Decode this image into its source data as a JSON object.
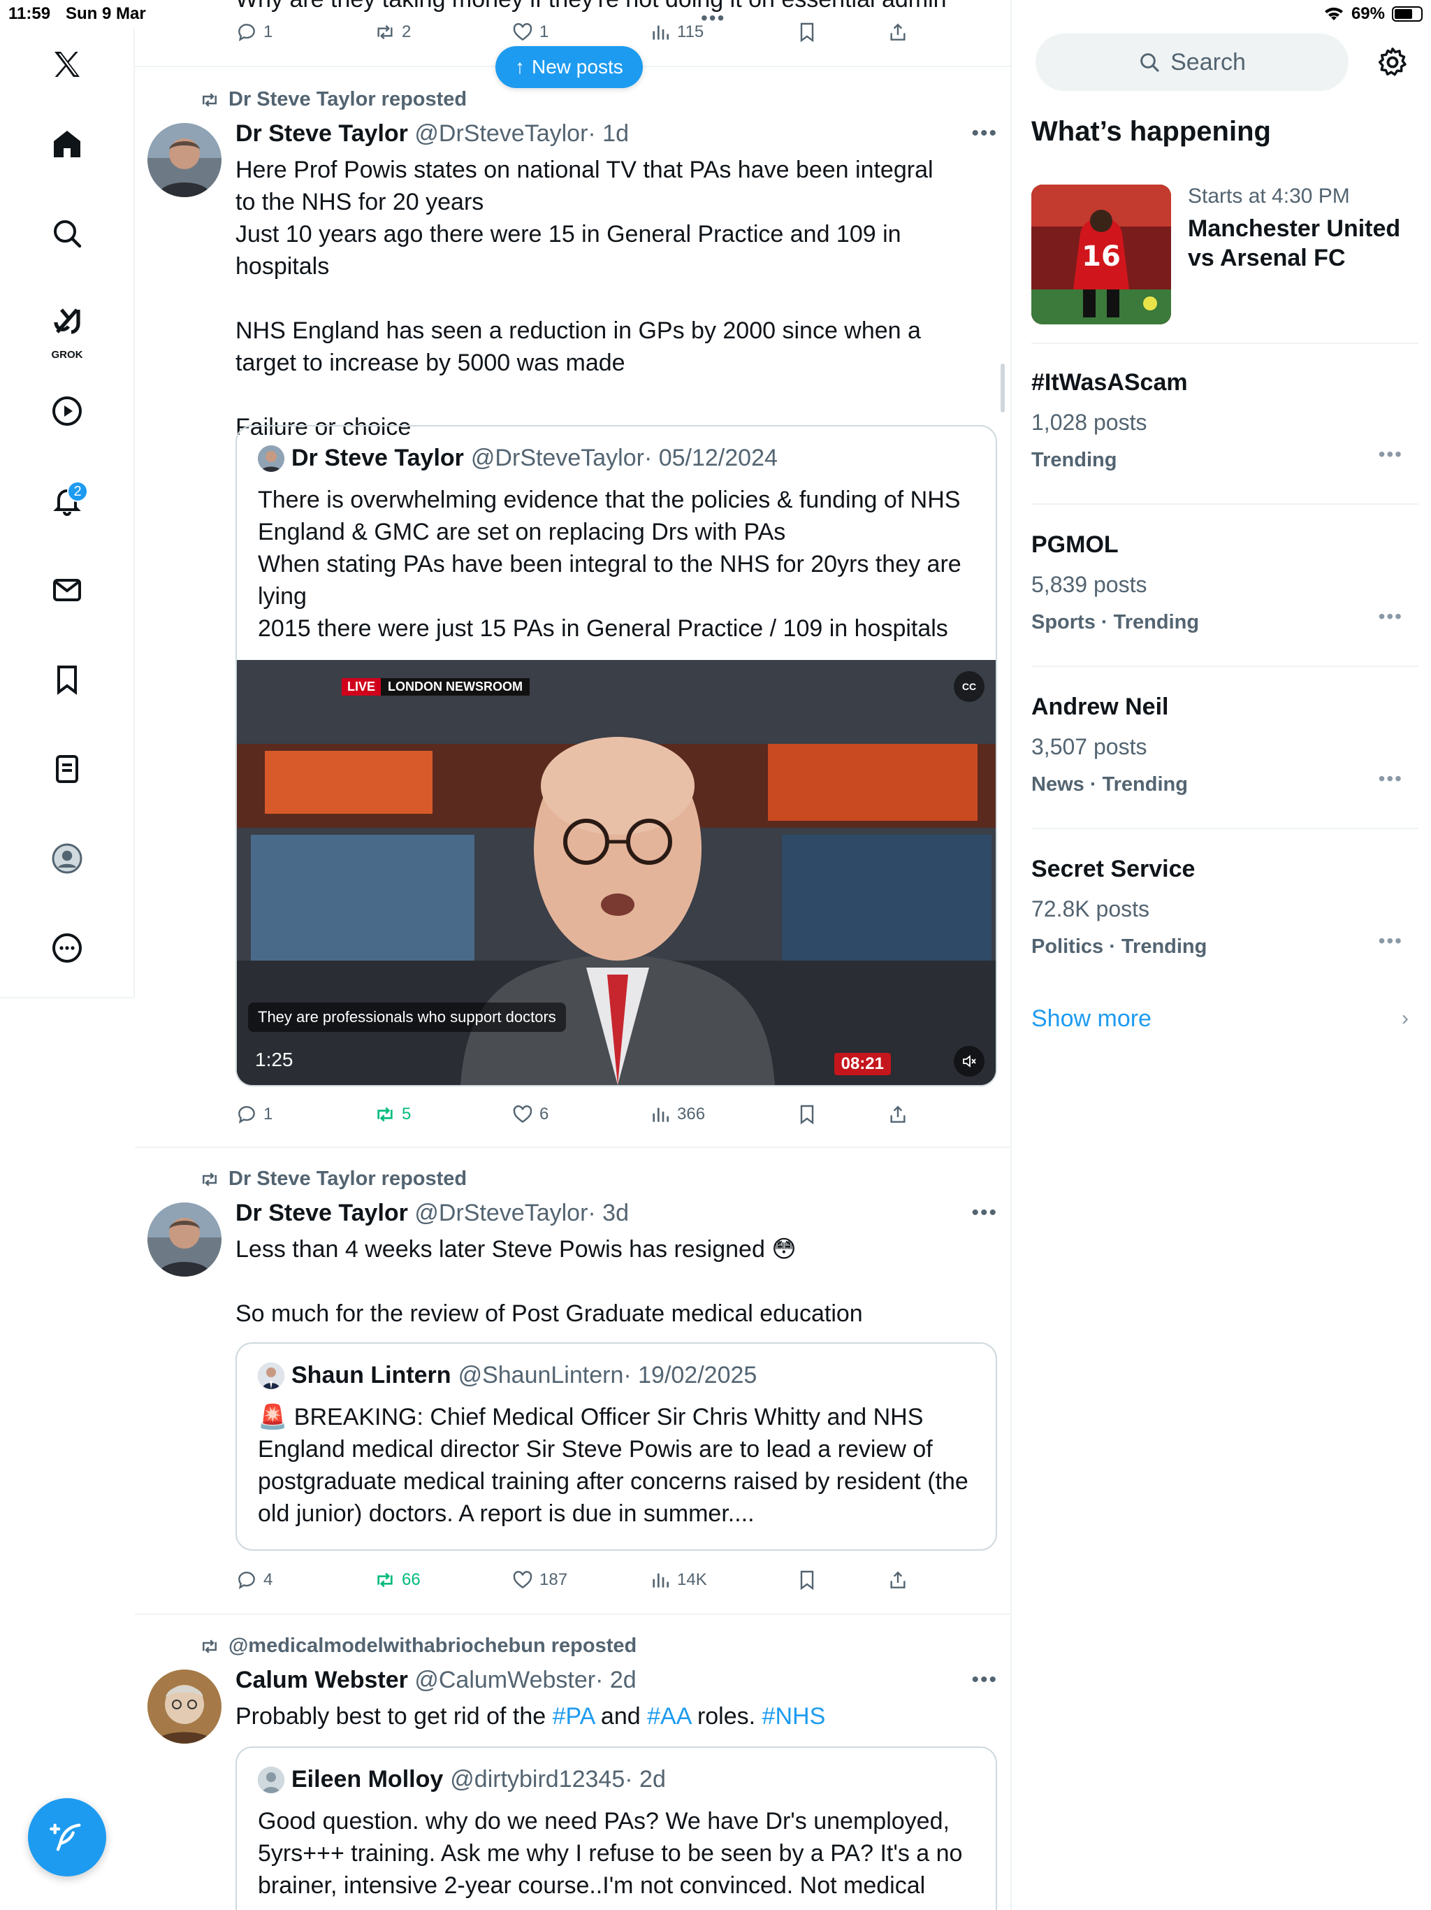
{
  "status_bar": {
    "time": "11:59",
    "date": "Sun 9 Mar",
    "battery": "69%",
    "battery_level": 0.69
  },
  "nav": {
    "items": [
      "x-logo",
      "home",
      "explore",
      "grok",
      "video",
      "notifications",
      "messages",
      "bookmarks",
      "lists",
      "profile",
      "more"
    ],
    "grok_label": "GROK",
    "notification_count": "2"
  },
  "timeline": {
    "cut_text": "Why are they taking money if they're not doing it on essential admin",
    "top_actions": {
      "replies": "1",
      "reposts": "2",
      "likes": "1",
      "views": "115"
    },
    "new_posts_label": "New posts",
    "posts": [
      {
        "repost_by": "Dr Steve Taylor reposted",
        "name": "Dr Steve Taylor",
        "handle": "@DrSteveTaylor",
        "time": "· 1d",
        "text": "Here Prof Powis states on national TV that PAs have been integral to the NHS for 20 years\nJust 10 years ago there were 15 in General Practice and 109 in hospitals\n\nNHS England has seen a reduction in GPs by 2000 since when a target to increase by 5000 was made\n\nFailure or choice",
        "quote": {
          "name": "Dr Steve Taylor",
          "handle": "@DrSteveTaylor",
          "time": "· 05/12/2024",
          "text": "There is overwhelming evidence that the policies & funding of NHS England & GMC are set on replacing Drs with PAs\nWhen stating PAs have been integral to the NHS for 20yrs they are lying\n2015 there were just 15 PAs in General Practice / 109 in hospitals",
          "video": {
            "live_label": "LIVE",
            "channel_label": "LONDON NEWSROOM",
            "caption": "They are professionals who support doctors",
            "elapsed": "1:25",
            "duration": "08:21",
            "cc_label": "CC"
          }
        },
        "actions": {
          "replies": "1",
          "reposts": "5",
          "likes": "6",
          "views": "366"
        }
      },
      {
        "repost_by": "Dr Steve Taylor reposted",
        "name": "Dr Steve Taylor",
        "handle": "@DrSteveTaylor",
        "time": "· 3d",
        "text": "Less than 4 weeks later Steve Powis has resigned 😳\n\nSo much for the review of Post Graduate medical education",
        "quote": {
          "name": "Shaun Lintern",
          "handle": "@ShaunLintern",
          "time": "· 19/02/2025",
          "text": "🚨 BREAKING: Chief Medical Officer Sir Chris Whitty and NHS England medical director Sir Steve Powis are to lead a review of postgraduate medical training after concerns raised by resident (the old junior) doctors. A report is due in summer...."
        },
        "actions": {
          "replies": "4",
          "reposts": "66",
          "likes": "187",
          "views": "14K"
        }
      },
      {
        "repost_by": "@medicalmodelwithabriochebun reposted",
        "name": "Calum Webster",
        "handle": "@CalumWebster",
        "time": "· 2d",
        "text_parts": [
          "Probably best to get rid of the ",
          "#PA",
          " and ",
          "#AA",
          " roles. ",
          "#NHS"
        ],
        "quote": {
          "name": "Eileen Molloy",
          "handle": "@dirtybird12345",
          "time": "· 2d",
          "text": "Good question. why do we need PAs? We have Dr's unemployed, 5yrs+++ training. Ask me why I refuse to be seen by a PA? It's a no brainer, intensive 2-year course..I'm not convinced. Not medical"
        }
      }
    ]
  },
  "sidebar": {
    "search_placeholder": "Search",
    "heading": "What’s happening",
    "event": {
      "pre": "Starts at 4:30 PM",
      "title": "Manchester United vs Arsenal FC",
      "shirt_number": "16"
    },
    "trends": [
      {
        "name": "#ItWasAScam",
        "count": "1,028 posts",
        "category": "Trending"
      },
      {
        "name": "PGMOL",
        "count": "5,839 posts",
        "category": "Sports · Trending"
      },
      {
        "name": "Andrew Neil",
        "count": "3,507 posts",
        "category": "News · Trending"
      },
      {
        "name": "Secret Service",
        "count": "72.8K posts",
        "category": "Politics · Trending"
      }
    ],
    "show_more": "Show more"
  },
  "colors": {
    "accent": "#1d9bf0",
    "repost_green": "#00ba7c",
    "muted": "#536471",
    "border": "#eff3f4"
  }
}
